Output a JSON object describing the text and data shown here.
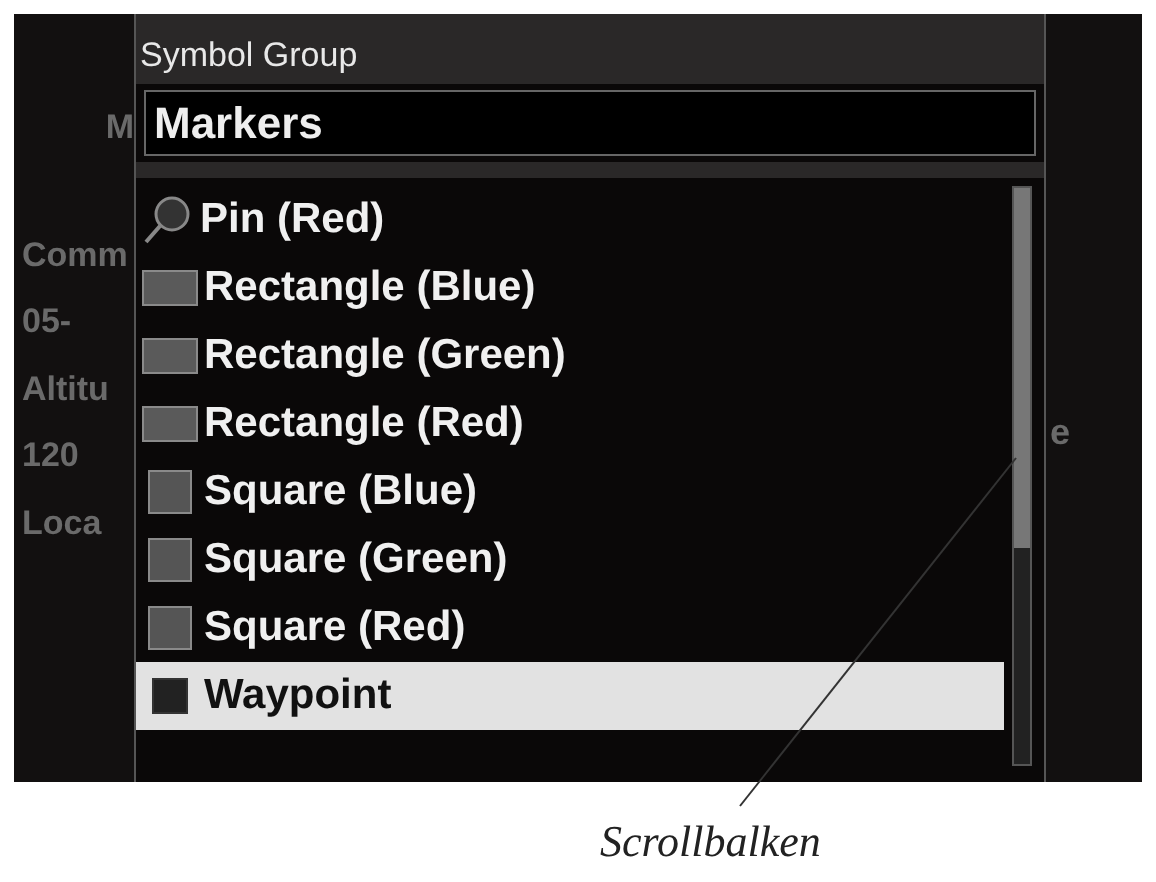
{
  "background": {
    "fragments": [
      "M",
      "Comm",
      "05-",
      "Altitu",
      "120",
      "Loca"
    ],
    "right_fragment": "e"
  },
  "popup": {
    "title": "Symbol Group",
    "field": {
      "value": "Markers"
    },
    "items": [
      {
        "kind": "pin",
        "label": "Pin (Red)",
        "selected": false
      },
      {
        "kind": "rectangle",
        "label": "Rectangle (Blue)",
        "selected": false
      },
      {
        "kind": "rectangle",
        "label": "Rectangle (Green)",
        "selected": false
      },
      {
        "kind": "rectangle",
        "label": "Rectangle (Red)",
        "selected": false
      },
      {
        "kind": "square",
        "label": "Square (Blue)",
        "selected": false
      },
      {
        "kind": "square",
        "label": "Square (Green)",
        "selected": false
      },
      {
        "kind": "square",
        "label": "Square (Red)",
        "selected": false
      },
      {
        "kind": "waypoint",
        "label": "Waypoint",
        "selected": true
      }
    ]
  },
  "annotation": {
    "label": "Scrollbalken"
  }
}
